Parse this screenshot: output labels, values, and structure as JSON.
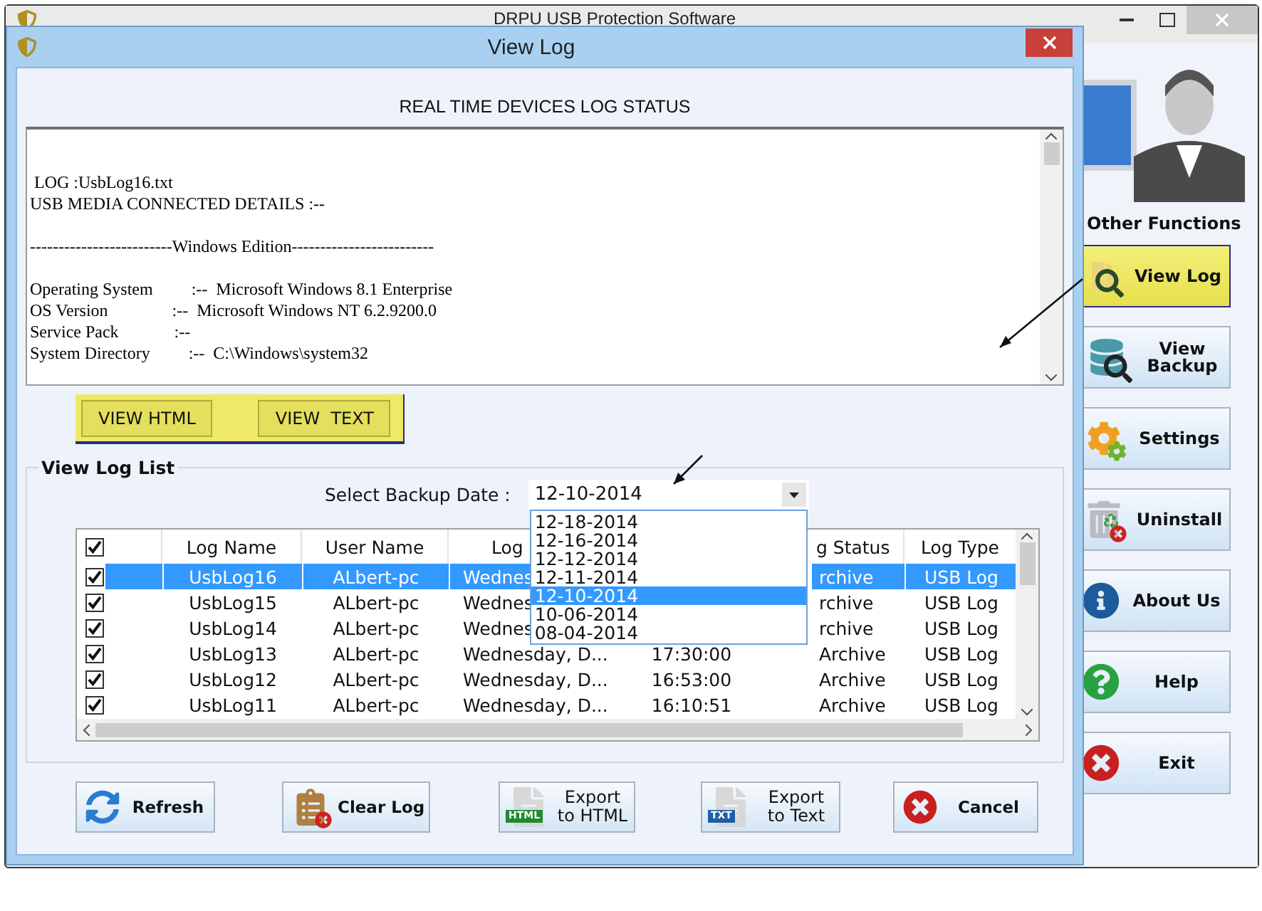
{
  "app": {
    "title": "DRPU USB Protection Software"
  },
  "sidebar": {
    "title": "Other Functions",
    "items": [
      {
        "label": "View Log",
        "kind": "viewlog",
        "selected": true
      },
      {
        "label": "View Backup",
        "kind": "backup",
        "selected": false
      },
      {
        "label": "Settings",
        "kind": "settings",
        "selected": false
      },
      {
        "label": "Uninstall",
        "kind": "uninstall",
        "selected": false
      },
      {
        "label": "About Us",
        "kind": "about",
        "selected": false
      },
      {
        "label": "Help",
        "kind": "help",
        "selected": false
      },
      {
        "label": "Exit",
        "kind": "exit",
        "selected": false
      }
    ]
  },
  "dialog": {
    "title": "View Log",
    "heading": "REAL TIME DEVICES  LOG STATUS",
    "log_lines": [
      {
        "text": " LOG :UsbLog16.txt",
        "gap_before": false
      },
      {
        "text": "USB MEDIA CONNECTED DETAILS :--",
        "gap_before": false
      },
      {
        "text": "-------------------------Windows Edition-------------------------",
        "gap_before": true
      },
      {
        "text": "Operating System         :--  Microsoft Windows 8.1 Enterprise",
        "gap_before": true
      },
      {
        "text": "OS Version               :--  Microsoft Windows NT 6.2.9200.0",
        "gap_before": false
      },
      {
        "text": "Service Pack             :--",
        "gap_before": false
      },
      {
        "text": "System Directory         :--  C:\\Windows\\system32",
        "gap_before": false
      }
    ],
    "view_buttons": [
      "VIEW HTML",
      "VIEW  TEXT"
    ],
    "list": {
      "title": "View Log List",
      "date_label": "Select Backup Date :",
      "date_value": "12-10-2014",
      "date_options": [
        {
          "label": "12-18-2014",
          "selected": false
        },
        {
          "label": "12-16-2014",
          "selected": false
        },
        {
          "label": "12-12-2014",
          "selected": false
        },
        {
          "label": "12-11-2014",
          "selected": false
        },
        {
          "label": "12-10-2014",
          "selected": true
        },
        {
          "label": "10-06-2014",
          "selected": false
        },
        {
          "label": "08-04-2014",
          "selected": false
        }
      ],
      "all_checked": true,
      "headers": {
        "log_name": "Log Name",
        "user_name": "User Name",
        "column_3": "Log",
        "column_5": "g Status",
        "log_type": "Log Type"
      },
      "rows": [
        {
          "checked": true,
          "selected": true,
          "name": "UsbLog16",
          "user": "ALbert-pc",
          "date": "Wednes",
          "status": "rchive",
          "type": "USB Log"
        },
        {
          "checked": true,
          "selected": false,
          "name": "UsbLog15",
          "user": "ALbert-pc",
          "date": "Wednes",
          "status": "rchive",
          "type": "USB Log"
        },
        {
          "checked": true,
          "selected": false,
          "name": "UsbLog14",
          "user": "ALbert-pc",
          "date": "Wednes",
          "status": "rchive",
          "type": "USB Log"
        },
        {
          "checked": true,
          "selected": false,
          "name": "UsbLog13",
          "user": "ALbert-pc",
          "date": "Wednesday, D...",
          "time": "17:30:00",
          "status": "Archive",
          "type": "USB Log"
        },
        {
          "checked": true,
          "selected": false,
          "name": "UsbLog12",
          "user": "ALbert-pc",
          "date": "Wednesday, D...",
          "time": "16:53:00",
          "status": "Archive",
          "type": "USB Log"
        },
        {
          "checked": true,
          "selected": false,
          "name": "UsbLog11",
          "user": "ALbert-pc",
          "date": "Wednesday, D...",
          "time": "16:10:51",
          "status": "Archive",
          "type": "USB Log"
        }
      ]
    },
    "buttons": [
      {
        "label": "Refresh",
        "kind": "refresh"
      },
      {
        "label": "Clear Log",
        "kind": "clear"
      },
      {
        "label": "Export to HTML",
        "kind": "html",
        "badge": "HTML"
      },
      {
        "label": "Export to Text",
        "kind": "txt",
        "badge": "TXT"
      },
      {
        "label": "Cancel",
        "kind": "cancel"
      }
    ]
  }
}
